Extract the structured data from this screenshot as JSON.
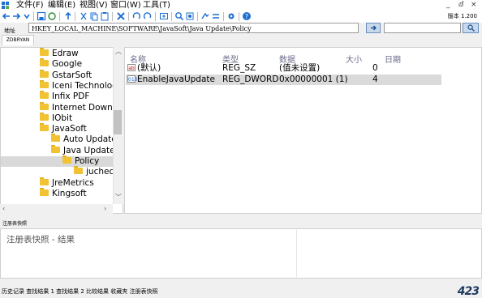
{
  "menu": {
    "items": [
      "文件(F)",
      "编辑(E)",
      "视图(V)",
      "窗口(W)",
      "工具(T)"
    ],
    "window_controls": [
      "_",
      "ⅆ",
      "×"
    ]
  },
  "toolbar": {
    "version": "版本 1.200"
  },
  "address": {
    "label": "地址",
    "value": "HKEY_LOCAL_MACHINE\\SOFTWARE\\JavaSoft\\Java Update\\Policy",
    "search_value": ""
  },
  "machine_tab": "ZDBRYAN",
  "tree": {
    "items": [
      {
        "label": "Edraw",
        "depth": 0
      },
      {
        "label": "Google",
        "depth": 0
      },
      {
        "label": "GstarSoft",
        "depth": 0
      },
      {
        "label": "Iceni Technology",
        "depth": 0
      },
      {
        "label": "Infix PDF",
        "depth": 0
      },
      {
        "label": "Internet Downloa",
        "depth": 0
      },
      {
        "label": "IObit",
        "depth": 0
      },
      {
        "label": "JavaSoft",
        "depth": 0
      },
      {
        "label": "Auto Update",
        "depth": 1
      },
      {
        "label": "Java Update",
        "depth": 1
      },
      {
        "label": "Policy",
        "depth": 2,
        "selected": true
      },
      {
        "label": "jucheck",
        "depth": 3
      },
      {
        "label": "JreMetrics",
        "depth": 0
      },
      {
        "label": "Kingsoft",
        "depth": 0
      }
    ]
  },
  "list": {
    "headers": [
      "名称",
      "类型",
      "数据",
      "大小",
      "日期"
    ],
    "rows": [
      {
        "icon": "ab",
        "name": "(默认)",
        "type": "REG_SZ",
        "data": "(值未设置)",
        "size": "0",
        "date": ""
      },
      {
        "icon": "010",
        "name": "EnableJavaUpdate",
        "type": "REG_DWORD",
        "data": "0x00000001 (1)",
        "size": "4",
        "date": "",
        "selected": true
      }
    ]
  },
  "snapshot": {
    "label": "注册表快照",
    "title": "注册表快照 - 结果"
  },
  "status": {
    "text": "历史记录  查找结果 1  查找结果 2  比较结果  收藏夹  注册表快照",
    "logo": "423"
  },
  "colors": {
    "folder": "#f1c232",
    "accent": "#1f6fc5",
    "selection": "#d9d9d9"
  }
}
